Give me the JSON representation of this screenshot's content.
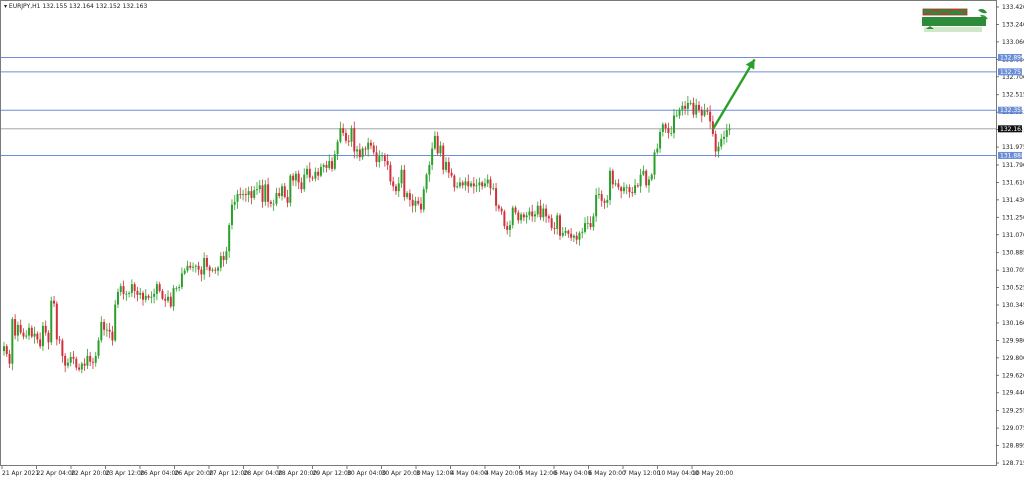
{
  "chart_data": {
    "type": "candlestick",
    "title": "EURJPY,H1  132.155 132.164 132.152 132.163",
    "symbol_timeframe": "EURJPY,H1",
    "ohlc_header": "132.155 132.164 132.152 132.163",
    "y_ticks": [
      "133.420",
      "133.240",
      "133.060",
      "132.880",
      "132.700",
      "132.515",
      "132.335",
      "132.155",
      "131.975",
      "131.790",
      "131.610",
      "131.430",
      "131.250",
      "131.070",
      "130.885",
      "130.705",
      "130.525",
      "130.345",
      "130.160",
      "129.980",
      "129.800",
      "129.620",
      "129.440",
      "129.255",
      "129.075",
      "128.895",
      "128.715"
    ],
    "x_ticks": [
      "21 Apr 2021",
      "22 Apr 04:00",
      "22 Apr 20:00",
      "23 Apr 12:00",
      "26 Apr 04:00",
      "26 Apr 20:00",
      "27 Apr 12:00",
      "28 Apr 04:00",
      "28 Apr 20:00",
      "29 Apr 12:00",
      "30 Apr 04:00",
      "30 Apr 20:00",
      "3 May 12:00",
      "4 May 04:00",
      "4 May 20:00",
      "5 May 12:00",
      "6 May 04:00",
      "6 May 20:00",
      "7 May 12:00",
      "10 May 04:00",
      "10 May 20:00"
    ],
    "ylim": [
      128.7,
      133.5
    ],
    "current_price": "132.163",
    "levels": [
      {
        "label": "132.899",
        "value": 132.899,
        "color": "#6a8fd8"
      },
      {
        "label": "132.751",
        "value": 132.751,
        "color": "#6a8fd8"
      },
      {
        "label": "132.355",
        "value": 132.355,
        "color": "#6a8fd8"
      },
      {
        "label": "131.888",
        "value": 131.888,
        "color": "#6a8fd8"
      }
    ],
    "price_line": {
      "value": 132.163,
      "color": "#999999"
    },
    "arrow": {
      "from": {
        "index": 255,
        "price": 132.16
      },
      "to": {
        "index": 270,
        "price": 132.88
      },
      "color": "#2aa02a"
    },
    "bull_color": "#2aa02a",
    "bear_color": "#d0303a",
    "candles": [
      129.92,
      129.84,
      129.74,
      130.2,
      130.03,
      130.14,
      130.06,
      130.02,
      130.03,
      130.11,
      130.02,
      130.05,
      129.99,
      129.92,
      130.13,
      130.06,
      129.96,
      130.39,
      130.36,
      129.99,
      129.98,
      129.82,
      129.72,
      129.75,
      129.81,
      129.79,
      129.7,
      129.68,
      129.74,
      129.72,
      129.82,
      129.76,
      129.75,
      129.82,
      129.98,
      130.17,
      130.09,
      130.09,
      130.07,
      129.98,
      130.35,
      130.48,
      130.54,
      130.46,
      130.46,
      130.47,
      130.56,
      130.49,
      130.45,
      130.47,
      130.4,
      130.44,
      130.42,
      130.43,
      130.46,
      130.56,
      130.49,
      130.41,
      130.39,
      130.43,
      130.33,
      130.52,
      130.52,
      130.53,
      130.67,
      130.7,
      130.75,
      130.73,
      130.74,
      130.75,
      130.71,
      130.66,
      130.83,
      130.74,
      130.7,
      130.71,
      130.7,
      130.73,
      130.85,
      130.81,
      130.9,
      131.17,
      131.38,
      131.41,
      131.49,
      131.48,
      131.49,
      131.48,
      131.52,
      131.45,
      131.53,
      131.54,
      131.58,
      131.41,
      131.59,
      131.41,
      131.39,
      131.39,
      131.5,
      131.47,
      131.57,
      131.46,
      131.4,
      131.68,
      131.63,
      131.7,
      131.61,
      131.54,
      131.69,
      131.75,
      131.66,
      131.65,
      131.72,
      131.68,
      131.77,
      131.79,
      131.76,
      131.83,
      131.75,
      131.9,
      132.03,
      132.17,
      132.12,
      132.04,
      132.03,
      132.17,
      131.93,
      131.95,
      131.87,
      131.96,
      131.95,
      132.02,
      131.99,
      131.92,
      131.82,
      131.88,
      131.89,
      131.83,
      131.79,
      131.62,
      131.57,
      131.52,
      131.6,
      131.74,
      131.46,
      131.5,
      131.43,
      131.37,
      131.42,
      131.39,
      131.33,
      131.54,
      131.69,
      131.79,
      131.96,
      132.09,
      131.91,
      131.99,
      131.74,
      131.82,
      131.71,
      131.68,
      131.56,
      131.57,
      131.61,
      131.58,
      131.62,
      131.57,
      131.6,
      131.57,
      131.58,
      131.61,
      131.57,
      131.6,
      131.64,
      131.55,
      131.55,
      131.37,
      131.34,
      131.31,
      131.16,
      131.12,
      131.17,
      131.35,
      131.3,
      131.22,
      131.28,
      131.25,
      131.27,
      131.31,
      131.26,
      131.28,
      131.37,
      131.25,
      131.34,
      131.26,
      131.24,
      131.14,
      131.13,
      131.27,
      131.06,
      131.09,
      131.11,
      131.08,
      131.04,
      131.06,
      131.02,
      131.09,
      131.1,
      131.19,
      131.19,
      131.15,
      131.26,
      131.48,
      131.49,
      131.42,
      131.4,
      131.43,
      131.73,
      131.59,
      131.6,
      131.56,
      131.52,
      131.56,
      131.56,
      131.51,
      131.5,
      131.58,
      131.57,
      131.69,
      131.73,
      131.58,
      131.64,
      131.69,
      131.92,
      131.96,
      132.13,
      132.21,
      132.17,
      132.12,
      132.12,
      132.3,
      132.3,
      132.36,
      132.4,
      132.37,
      132.43,
      132.43,
      132.31,
      132.41,
      132.36,
      132.3,
      132.35,
      132.34,
      132.24,
      132.11,
      131.93,
      131.98,
      132.06,
      132.08,
      132.15,
      132.16
    ]
  }
}
